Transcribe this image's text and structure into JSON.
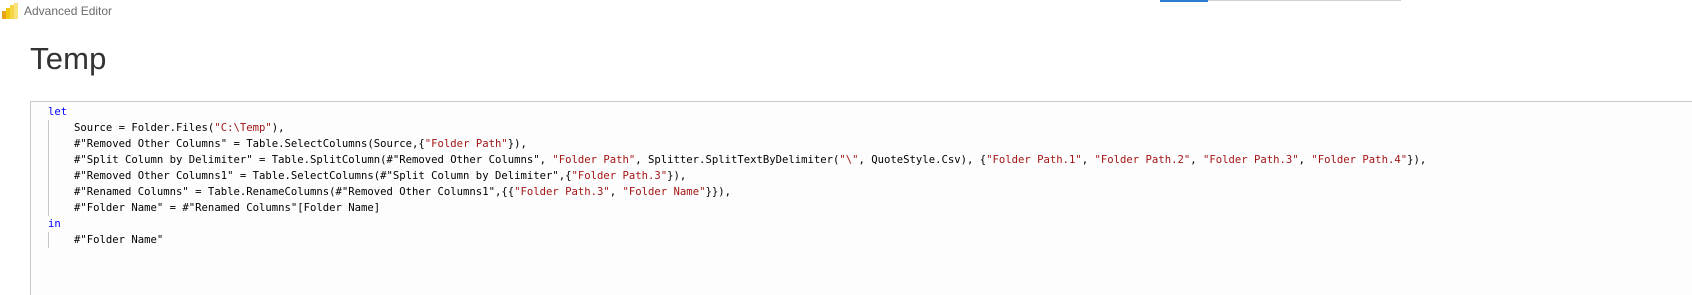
{
  "window": {
    "title": "Advanced Editor",
    "icon": "power-bi-icon"
  },
  "query": {
    "name": "Temp"
  },
  "editor": {
    "lines": [
      {
        "indent": 0,
        "tokens": [
          {
            "t": "let",
            "k": "kw"
          }
        ]
      },
      {
        "indent": 1,
        "tokens": [
          {
            "t": "Source = Folder.Files(",
            "k": "p"
          },
          {
            "t": "\"C:\\Temp\"",
            "k": "str"
          },
          {
            "t": "),",
            "k": "p"
          }
        ]
      },
      {
        "indent": 1,
        "tokens": [
          {
            "t": "#\"Removed Other Columns\" = Table.SelectColumns(Source,{",
            "k": "p"
          },
          {
            "t": "\"Folder Path\"",
            "k": "str"
          },
          {
            "t": "}),",
            "k": "p"
          }
        ]
      },
      {
        "indent": 1,
        "tokens": [
          {
            "t": "#\"Split Column by Delimiter\" = Table.SplitColumn(#\"Removed Other Columns\", ",
            "k": "p"
          },
          {
            "t": "\"Folder Path\"",
            "k": "str"
          },
          {
            "t": ", Splitter.SplitTextByDelimiter(",
            "k": "p"
          },
          {
            "t": "\"\\\"",
            "k": "str"
          },
          {
            "t": ", QuoteStyle.Csv), {",
            "k": "p"
          },
          {
            "t": "\"Folder Path.1\"",
            "k": "str"
          },
          {
            "t": ", ",
            "k": "p"
          },
          {
            "t": "\"Folder Path.2\"",
            "k": "str"
          },
          {
            "t": ", ",
            "k": "p"
          },
          {
            "t": "\"Folder Path.3\"",
            "k": "str"
          },
          {
            "t": ", ",
            "k": "p"
          },
          {
            "t": "\"Folder Path.4\"",
            "k": "str"
          },
          {
            "t": "}),",
            "k": "p"
          }
        ]
      },
      {
        "indent": 1,
        "tokens": [
          {
            "t": "#\"Removed Other Columns1\" = Table.SelectColumns(#\"Split Column by Delimiter\",{",
            "k": "p"
          },
          {
            "t": "\"Folder Path.3\"",
            "k": "str"
          },
          {
            "t": "}),",
            "k": "p"
          }
        ]
      },
      {
        "indent": 1,
        "tokens": [
          {
            "t": "#\"Renamed Columns\" = Table.RenameColumns(#\"Removed Other Columns1\",{{",
            "k": "p"
          },
          {
            "t": "\"Folder Path.3\"",
            "k": "str"
          },
          {
            "t": ", ",
            "k": "p"
          },
          {
            "t": "\"Folder Name\"",
            "k": "str"
          },
          {
            "t": "}}),",
            "k": "p"
          }
        ]
      },
      {
        "indent": 1,
        "tokens": [
          {
            "t": "#\"Folder Name\" = #\"Renamed Columns\"[Folder Name]",
            "k": "p"
          }
        ]
      },
      {
        "indent": 0,
        "tokens": [
          {
            "t": "in",
            "k": "kw"
          }
        ]
      },
      {
        "indent": 1,
        "tokens": [
          {
            "t": "#\"Folder Name\"",
            "k": "p"
          }
        ]
      }
    ]
  },
  "colors": {
    "keyword": "#0000ff",
    "string": "#a31515",
    "plain": "#000000",
    "accent": "#2b7cd3"
  }
}
